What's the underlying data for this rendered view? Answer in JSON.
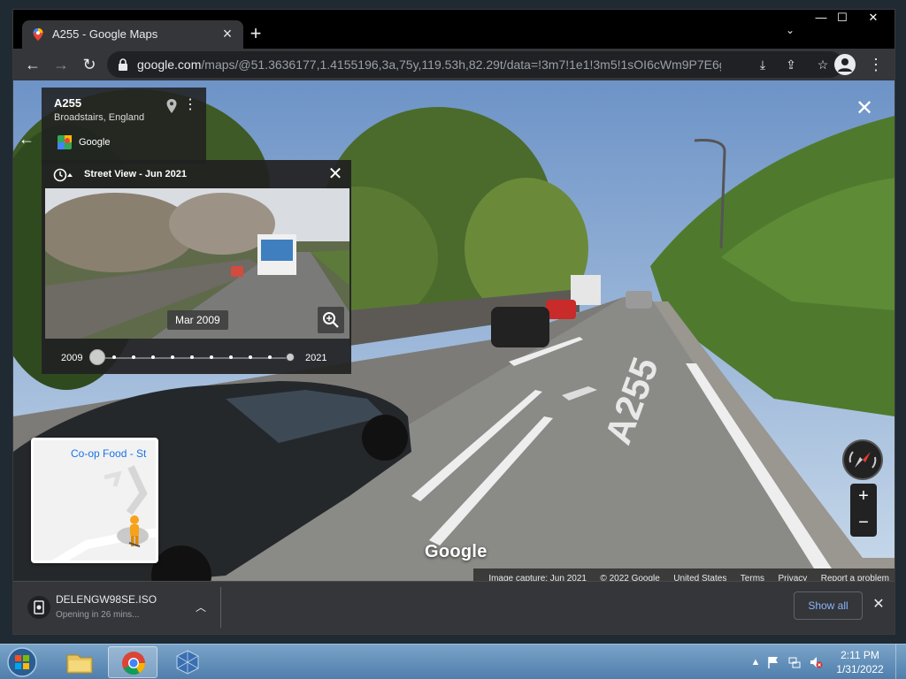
{
  "tab": {
    "title": "A255 - Google Maps",
    "close_icon": "×",
    "new_tab_icon": "+",
    "search_tabs_icon": "⌄"
  },
  "window_controls": {
    "minimize": "—",
    "maximize": "☐",
    "close": "✕"
  },
  "toolbar": {
    "back_icon": "←",
    "forward_icon": "→",
    "reload_icon": "↻",
    "url_host": "google.com",
    "url_path": "/maps/@51.3636177,1.4155196,3a,75y,119.53h,82.29t/data=!3m7!1e1!3m5!1sOI6cWm9P7E6gY...",
    "install_icon": "⤓",
    "share_icon": "⇪",
    "star_icon": "☆",
    "menu_icon": "⋮"
  },
  "place": {
    "title": "A255",
    "subtitle": "Broadstairs, England",
    "source": "Google",
    "more_icon": "⋮",
    "back_icon": "←"
  },
  "time_travel": {
    "title": "Street View - Jun 2021",
    "close_icon": "✕",
    "thumb_date": "Mar 2009",
    "year_start": "2009",
    "year_end": "2021",
    "tick_count": 10
  },
  "street_view": {
    "close_icon": "✕",
    "road_marking": "A255",
    "google_logo": "Google"
  },
  "minimap": {
    "label": "Co-op Food - St"
  },
  "footer": {
    "items": [
      "Image capture: Jun 2021",
      "© 2022 Google",
      "United States",
      "Terms",
      "Privacy",
      "Report a problem"
    ]
  },
  "zoom": {
    "in": "+",
    "out": "−"
  },
  "download": {
    "filename": "DELENGW98SE.ISO",
    "status": "Opening in 26 mins...",
    "chevron": "︿",
    "show_all": "Show all",
    "close_icon": "✕"
  },
  "taskbar": {
    "time": "2:11 PM",
    "date": "1/31/2022",
    "tray_up": "▲"
  },
  "colors": {
    "accent_blue": "#8ab4f8",
    "map_link": "#1a73e8",
    "sky": "#88a9cf",
    "hedge": "#4f7a2e",
    "road": "#8a8a87"
  }
}
